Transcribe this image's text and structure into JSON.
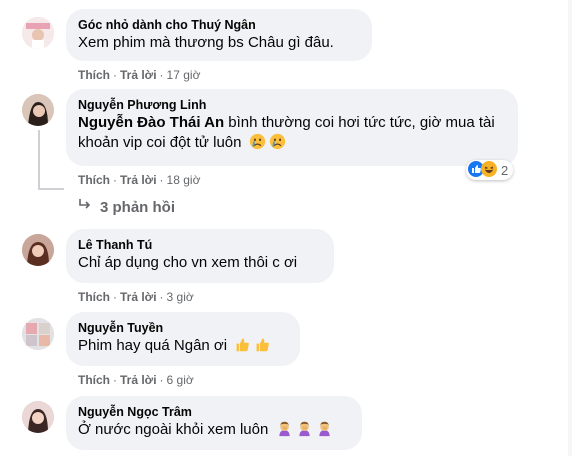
{
  "colors": {
    "bubble_bg": "#f0f2f5",
    "meta_text": "#65676b",
    "like_blue": "#1877f2",
    "haha_yellow": "#f7b125"
  },
  "comments": [
    {
      "author": "Góc nhỏ dành cho Thuý Ngân",
      "text": "Xem phim mà thương bs Châu gì đâu.",
      "like": "Thích",
      "reply": "Trả lời",
      "time": "17 giờ",
      "sep": "·"
    },
    {
      "author": "Nguyễn Phương Linh",
      "mention": "Nguyễn Đào Thái An",
      "text": " bình thường coi hơi tức tức, giờ mua tài khoản vip coi đột tử luôn",
      "like": "Thích",
      "reply": "Trả lời",
      "time": "18 giờ",
      "sep": "·",
      "reaction_count": "2",
      "reaction_icons": [
        "like-icon",
        "haha-icon"
      ],
      "text_emojis": [
        "crying-face-icon",
        "crying-face-icon"
      ]
    },
    {
      "author": "Lê Thanh Tú",
      "text": "Chỉ áp dụng cho vn xem thôi c ơi",
      "like": "Thích",
      "reply": "Trả lời",
      "time": "3 giờ",
      "sep": "·"
    },
    {
      "author": "Nguyễn Tuyền",
      "text": "Phim hay quá Ngân ơi",
      "like": "Thích",
      "reply": "Trả lời",
      "time": "6 giờ",
      "sep": "·",
      "text_emojis": [
        "thumbs-up-icon",
        "thumbs-up-icon"
      ]
    },
    {
      "author": "Nguyễn Ngọc Trâm",
      "text": "Ở nước ngoài khỏi xem luôn",
      "text_emojis": [
        "facepalm-icon",
        "facepalm-icon",
        "facepalm-icon"
      ]
    }
  ],
  "replies": {
    "label": "3 phản hồi",
    "icon": "reply-arrow-icon"
  }
}
